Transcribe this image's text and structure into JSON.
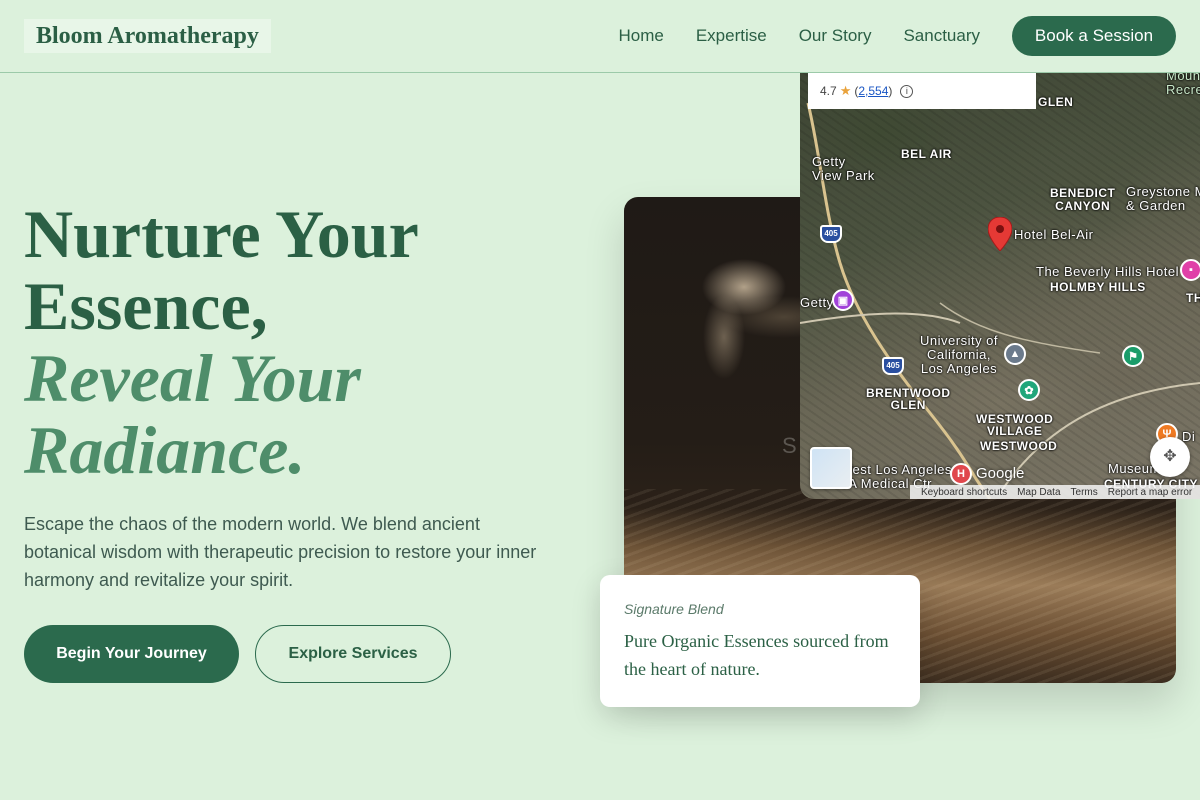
{
  "header": {
    "logo": "Bloom Aromatherapy",
    "nav": [
      "Home",
      "Expertise",
      "Our Story",
      "Sanctuary"
    ],
    "cta": "Book a Session"
  },
  "hero": {
    "line1": "Nurture Your",
    "line2": "Essence,",
    "line3": "Reveal Your",
    "line4": "Radiance.",
    "lede": "Escape the chaos of the modern world. We blend ancient botanical wisdom with therapeutic precision to restore your inner harmony and revitalize your spirit.",
    "primary_button": "Begin Your Journey",
    "secondary_button": "Explore Services"
  },
  "photo": {
    "overlay_text": "S"
  },
  "map": {
    "rating": "4.7",
    "review_count": "2,554",
    "labels": {
      "glen": "GLEN",
      "bel_air": "BEL AIR",
      "getty_view_park": "Getty\nView Park",
      "hotel_bel_air": "Hotel Bel-Air",
      "benedict_canyon": "BENEDICT\nCANYON",
      "greystone": "Greystone M\n& Garden",
      "beverly_hills_hotel": "The Beverly Hills Hotel",
      "holmby_hills": "HOLMBY HILLS",
      "getty": "Getty",
      "ucla": "University of\nCalifornia,\nLos Angeles",
      "brentwood_glen": "BRENTWOOD\nGLEN",
      "westwood_village": "WESTWOOD\nVILLAGE",
      "westwood": "WESTWOOD",
      "west_la_va": "West Los Angeles\nVA Medical Ctr",
      "museum": "Museum",
      "century_city": "CENTURY CITY",
      "mount_recreation": "Mount\nRecre",
      "th": "TH",
      "di": "Di"
    },
    "shield_405": "405",
    "google": "Google",
    "attribution": [
      "Keyboard shortcuts",
      "Map Data",
      "Terms",
      "Report a map error"
    ]
  },
  "blend": {
    "label": "Signature Blend",
    "description": "Pure Organic Essences sourced from the heart of nature."
  },
  "colors": {
    "background": "#dcf1dc",
    "primary": "#2b6a4d",
    "accent_italic": "#4e8d6a"
  },
  "icons": {
    "star": "star-icon",
    "info": "info-icon",
    "marker": "map-marker-icon",
    "hospital": "hospital-icon",
    "museum": "museum-icon",
    "school": "school-icon",
    "park": "park-icon",
    "pan": "pan-control-icon"
  }
}
